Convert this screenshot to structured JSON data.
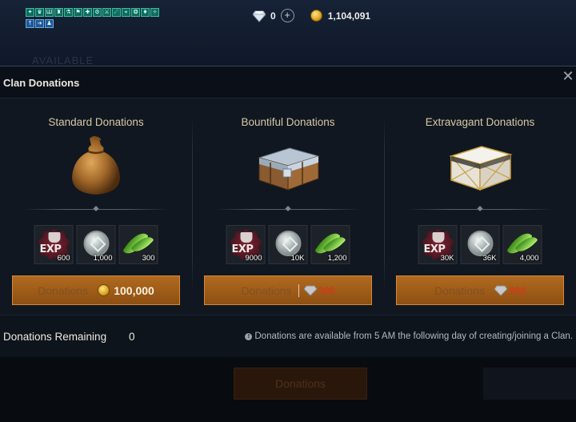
{
  "hud": {
    "buffs_row1": [
      "✦",
      "♛",
      "Ш",
      "♜",
      "⚗",
      "⚑",
      "✚",
      "⚙",
      "⚔",
      "☄",
      "⌖",
      "❂",
      "♦",
      "✧"
    ],
    "buffs_row2": [
      "↑",
      "➔",
      "♟"
    ],
    "diamonds": "0",
    "gold": "1,104,091",
    "ghost_text": "AVAILABLE"
  },
  "panel": {
    "title": "Clan Donations",
    "close_icon": "close-icon"
  },
  "tiers": [
    {
      "title": "Standard Donations",
      "icon": "sack-icon",
      "rewards": [
        {
          "icon": "exp-icon",
          "label": "EXP",
          "qty": "600"
        },
        {
          "icon": "silver-coin-icon",
          "qty": "1,000"
        },
        {
          "icon": "leaf-icon",
          "qty": "300"
        }
      ],
      "button_label": "Donations",
      "currency_icon": "gold-coin-icon",
      "cost": "100,000"
    },
    {
      "title": "Bountiful Donations",
      "icon": "chest-icon",
      "rewards": [
        {
          "icon": "exp-icon",
          "label": "EXP",
          "qty": "9000"
        },
        {
          "icon": "silver-coin-icon",
          "qty": "10K"
        },
        {
          "icon": "leaf-icon",
          "qty": "1,200"
        }
      ],
      "button_label": "Donations",
      "currency_icon": "diamond-icon",
      "cost": "300"
    },
    {
      "title": "Extravagant Donations",
      "icon": "ornate-chest-icon",
      "rewards": [
        {
          "icon": "exp-icon",
          "label": "EXP",
          "qty": "30K"
        },
        {
          "icon": "silver-coin-icon",
          "qty": "36K"
        },
        {
          "icon": "leaf-icon",
          "qty": "4,000"
        }
      ],
      "button_label": "Donations",
      "currency_icon": "diamond-icon",
      "cost": "900"
    }
  ],
  "footer": {
    "remaining_label": "Donations Remaining",
    "remaining_value": "0",
    "info_text": "Donations are available from 5 AM the following day of creating/joining a Clan."
  },
  "bottom": {
    "ghost_button": "Donations"
  },
  "colors": {
    "accent_button": "#a05d18",
    "cost_red": "#d13a1a",
    "title_gold": "#d6c9a6"
  }
}
